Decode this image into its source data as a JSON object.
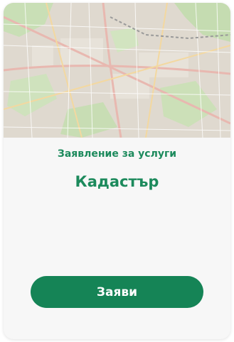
{
  "card": {
    "image_alt": "map",
    "subtitle": "Заявление за услуги",
    "title": "Кадастър",
    "button_label": "Заяви"
  },
  "colors": {
    "accent": "#158456",
    "accent_text": "#1c8a5c",
    "card_bg": "#f7f7f7"
  }
}
